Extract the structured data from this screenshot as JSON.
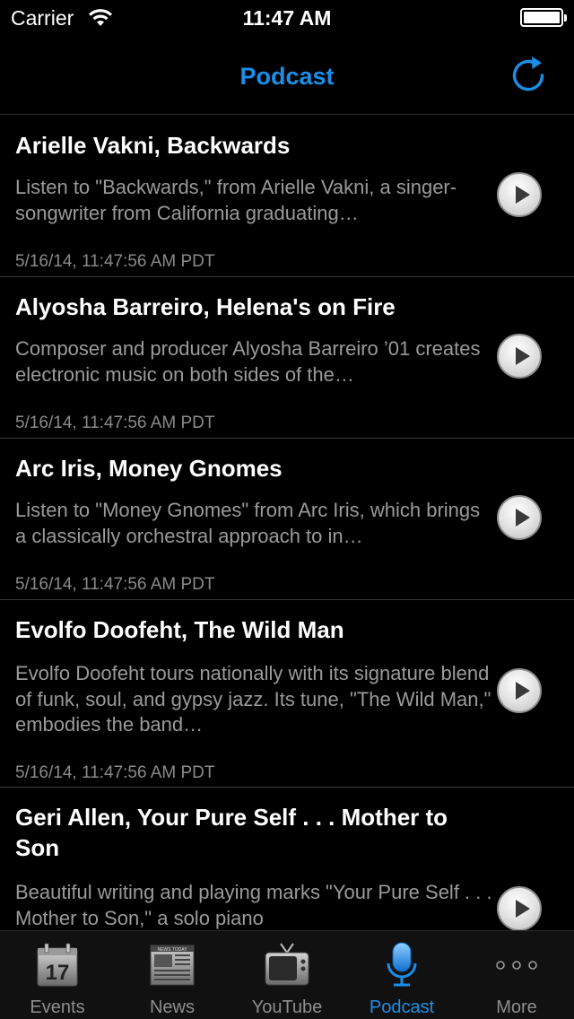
{
  "status_bar": {
    "carrier": "Carrier",
    "time": "11:47 AM",
    "wifi_icon": "wifi-icon",
    "battery_icon": "battery-icon"
  },
  "nav": {
    "title": "Podcast",
    "refresh_icon": "refresh-icon"
  },
  "episodes": [
    {
      "title": "Arielle Vakni, Backwards",
      "description": "Listen to \"Backwards,\" from Arielle Vakni, a singer-songwriter from California graduating…",
      "date": "5/16/14, 11:47:56 AM PDT"
    },
    {
      "title": "Alyosha Barreiro, Helena's on Fire",
      "description": "Composer and producer Alyosha Barreiro ’01 creates electronic music on both sides of the…",
      "date": "5/16/14, 11:47:56 AM PDT"
    },
    {
      "title": "Arc Iris, Money Gnomes",
      "description": "Listen to \"Money Gnomes\" from Arc Iris, which brings a classically orchestral approach to in…",
      "date": "5/16/14, 11:47:56 AM PDT"
    },
    {
      "title": "Evolfo Doofeht, The Wild Man",
      "description": "Evolfo Doofeht tours nationally with its signature blend of funk, soul, and gypsy jazz. Its tune, \"The Wild Man,\" embodies the band…",
      "date": "5/16/14, 11:47:56 AM PDT"
    },
    {
      "title": "Geri Allen, Your Pure Self . . . Mother to Son",
      "description": "Beautiful writing and playing marks \"Your Pure Self . . . Mother to Son,\" a solo piano",
      "date": ""
    }
  ],
  "tabs": [
    {
      "label": "Events",
      "icon": "calendar-icon",
      "calendar_day": "17",
      "active": false
    },
    {
      "label": "News",
      "icon": "newspaper-icon",
      "newspaper_mast": "NEWS TODAY",
      "active": false
    },
    {
      "label": "YouTube",
      "icon": "tv-icon",
      "active": false
    },
    {
      "label": "Podcast",
      "icon": "microphone-icon",
      "active": true
    },
    {
      "label": "More",
      "icon": "more-icon",
      "active": false
    }
  ],
  "colors": {
    "accent": "#1a8fe8",
    "background": "#000000",
    "description_text": "#9a9a9a",
    "date_text": "#8a8a8a",
    "inactive_tab": "#8e8e8e"
  }
}
